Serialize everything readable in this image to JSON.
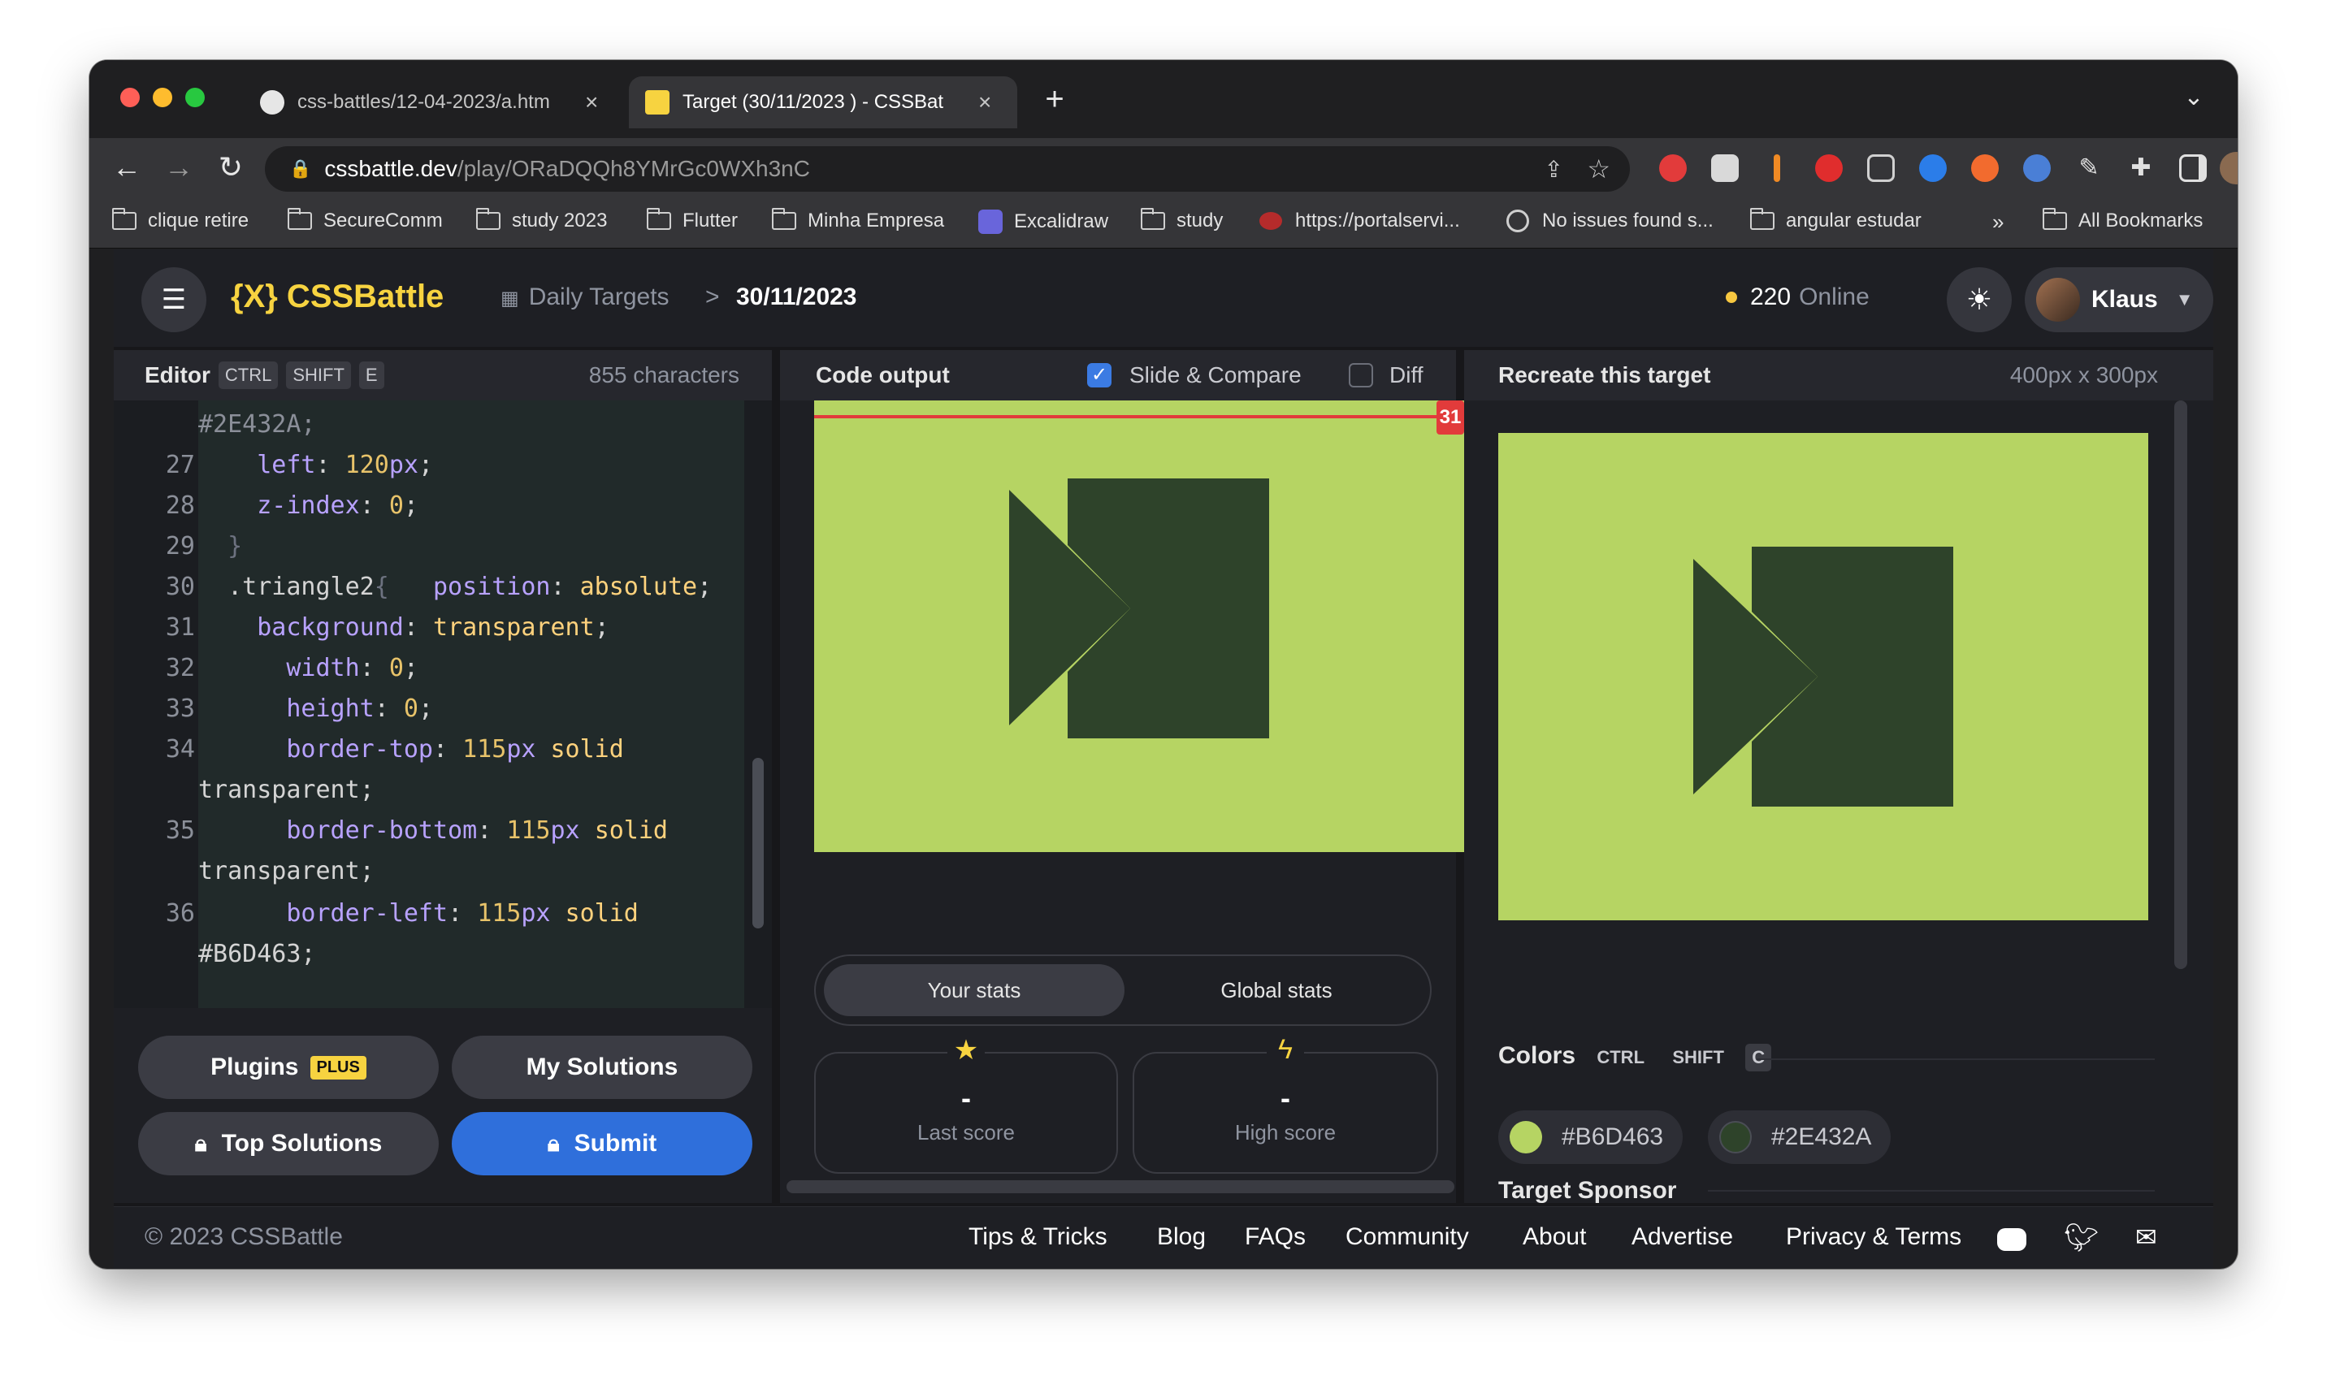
{
  "browser": {
    "tabs": [
      {
        "title": "css-battles/12-04-2023/a.htm",
        "close": "×"
      },
      {
        "title": "Target (30/11/2023 ) - CSSBat",
        "close": "×"
      }
    ],
    "new_tab": "+",
    "tab_menu": "⌄",
    "url_host": "cssbattle.dev",
    "url_path": "/play/ORaDQQh8YMrGc0WXh3nC",
    "bookmarks": [
      "clique retire",
      "SecureComm",
      "study 2023",
      "Flutter",
      "Minha Empresa",
      "Excalidraw",
      "study",
      "https://portalservi...",
      "No issues found s...",
      "angular estudar",
      "»",
      "All Bookmarks"
    ]
  },
  "header": {
    "logo": "{X} CSSBattle",
    "breadcrumb_daily": "Daily Targets",
    "breadcrumb_sep": ">",
    "breadcrumb_date": "30/11/2023",
    "online_count": "220",
    "online_label": "Online",
    "user_name": "Klaus"
  },
  "editor": {
    "title": "Editor",
    "kbd": [
      "CTRL",
      "SHIFT",
      "E"
    ],
    "char_count": "855 characters",
    "line_numbers": [
      "27",
      "28",
      "29",
      "30",
      "31",
      "32",
      "33",
      "34",
      "35",
      "36"
    ],
    "lines": [
      "#2E432A;",
      "    left: 120px;",
      "    z-index: 0;",
      "  }",
      "  .triangle2{   position: absolute;",
      "    background: transparent;",
      "      width: 0;",
      "      height: 0;",
      "      border-top: 115px solid",
      "transparent;",
      "      border-bottom: 115px solid",
      "transparent;",
      "      border-left: 115px solid",
      "#B6D463;"
    ],
    "buttons": {
      "plugins": "Plugins",
      "plus": "PLUS",
      "my_solutions": "My Solutions",
      "top_solutions": "Top Solutions",
      "submit": "Submit"
    }
  },
  "output": {
    "title": "Code output",
    "slide_compare": "Slide & Compare",
    "diff": "Diff",
    "slider_value": "31",
    "stats_tabs": [
      "Your stats",
      "Global stats"
    ],
    "last_score_value": "-",
    "last_score_label": "Last score",
    "high_score_value": "-",
    "high_score_label": "High score"
  },
  "target": {
    "title": "Recreate this target",
    "size": "400px x 300px",
    "colors_label": "Colors",
    "colors_kbd": [
      "CTRL",
      "SHIFT",
      "C"
    ],
    "colors": [
      {
        "hex": "#B6D463"
      },
      {
        "hex": "#2E432A"
      }
    ],
    "sponsor_label": "Target Sponsor"
  },
  "footer": {
    "copyright": "© 2023 CSSBattle",
    "links": [
      "Tips & Tricks",
      "Blog",
      "FAQs",
      "Community",
      "About",
      "Advertise",
      "Privacy & Terms"
    ]
  },
  "theme": {
    "accent_yellow": "#F7D340",
    "submit_blue": "#2F6FDB",
    "target_bg": "#B6D463",
    "target_fg": "#2E432A"
  }
}
